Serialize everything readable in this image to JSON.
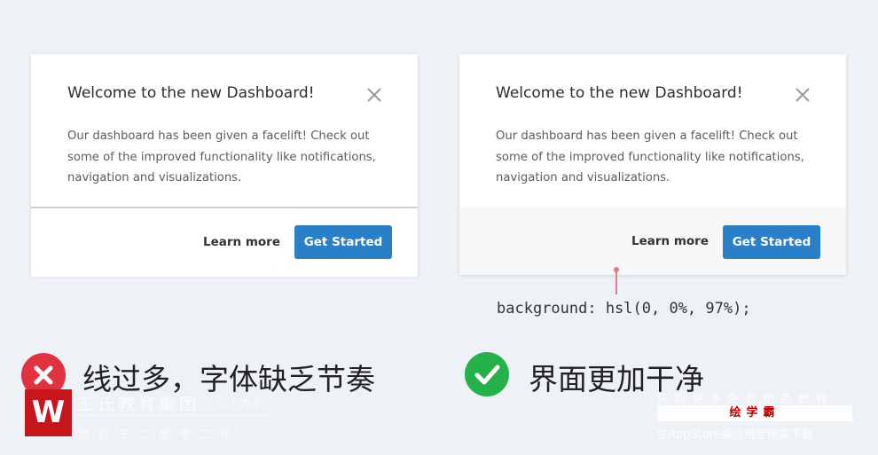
{
  "modal_left": {
    "title": "Welcome to the new Dashboard!",
    "body": "Our dashboard has been given a facelift! Check out some of the improved functionality like notifications, navigation and visualizations.",
    "secondary_label": "Learn more",
    "primary_label": "Get Started"
  },
  "modal_right": {
    "title": "Welcome to the new Dashboard!",
    "body": "Our dashboard has been given a facelift! Check out some of the improved functionality like notifications, navigation and visualizations.",
    "secondary_label": "Learn more",
    "primary_label": "Get Started"
  },
  "css_note": "background: hsl(0, 0%, 97%);",
  "verdicts": {
    "bad": "线过多，字体缺乏节奏",
    "good": "界面更加干净"
  },
  "watermark": {
    "logo_letter": "W",
    "left_line1": "王氏教育集团",
    "left_line1b": "以人为本",
    "left_line2": "始创于二零零二年",
    "right_line1": "获取更多免费精品教程",
    "brand": "绘学霸",
    "right_line2": "在AppStore或应用宝搜索下载"
  },
  "colors": {
    "primary": "#2a7fc9",
    "bad": "#e0323f",
    "good": "#25b24a",
    "footer_bg": "hsl(0, 0%, 97%)"
  },
  "icons": [
    "close-icon",
    "x-circle-icon",
    "check-circle-icon"
  ]
}
